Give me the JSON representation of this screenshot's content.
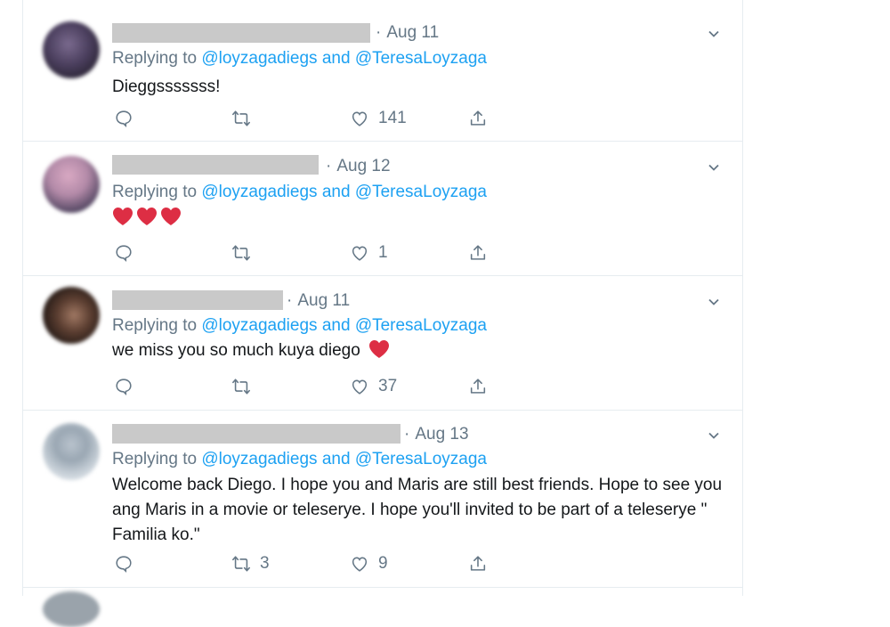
{
  "colors": {
    "link": "#1da1f2",
    "muted": "#657786",
    "text": "#14171a",
    "heart": "#dd2e44",
    "border": "#e6ecf0"
  },
  "tweets": [
    {
      "date": "Aug 11",
      "replying_prefix": "Replying to",
      "mention_1": "@loyzagadiegs",
      "and": "and",
      "mention_2": "@TeresaLoyzaga",
      "text": "Dieggsssssss!",
      "reply_count": "",
      "retweet_count": "",
      "like_count": "141"
    },
    {
      "date": "Aug 12",
      "replying_prefix": "Replying to",
      "mention_1": "@loyzagadiegs",
      "and": "and",
      "mention_2": "@TeresaLoyzaga",
      "text": "",
      "emoji": [
        "red-heart",
        "red-heart",
        "red-heart"
      ],
      "reply_count": "",
      "retweet_count": "",
      "like_count": "1"
    },
    {
      "date": "Aug 11",
      "replying_prefix": "Replying to",
      "mention_1": "@loyzagadiegs",
      "and": "and",
      "mention_2": "@TeresaLoyzaga",
      "text": "we miss you so much kuya diego",
      "emoji": [
        "red-heart"
      ],
      "reply_count": "",
      "retweet_count": "",
      "like_count": "37"
    },
    {
      "date": "Aug 13",
      "replying_prefix": "Replying to",
      "mention_1": "@loyzagadiegs",
      "and": "and",
      "mention_2": "@TeresaLoyzaga",
      "text": "Welcome back Diego. I hope you and Maris are still best friends. Hope to see you ang Maris in a movie or teleserye. I hope you'll invited to be part of a teleserye \" Familia ko.\"",
      "reply_count": "",
      "retweet_count": "3",
      "like_count": "9"
    }
  ]
}
